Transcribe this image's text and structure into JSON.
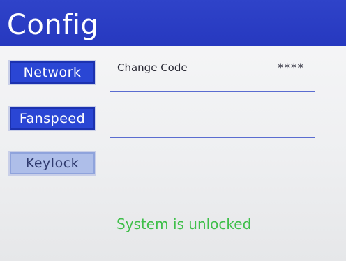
{
  "header": {
    "title": "Config"
  },
  "nav": {
    "network": "Network",
    "fanspeed": "Fanspeed",
    "keylock": "Keylock"
  },
  "settings": {
    "change_code_label": "Change Code",
    "change_code_value": "****"
  },
  "status": {
    "message": "System is unlocked"
  },
  "colors": {
    "header_bg": "#2638bf",
    "button_active": "#2a46d4",
    "button_selected": "#aebee9",
    "status_text": "#3fbf4a",
    "divider": "#5a6cd0"
  }
}
